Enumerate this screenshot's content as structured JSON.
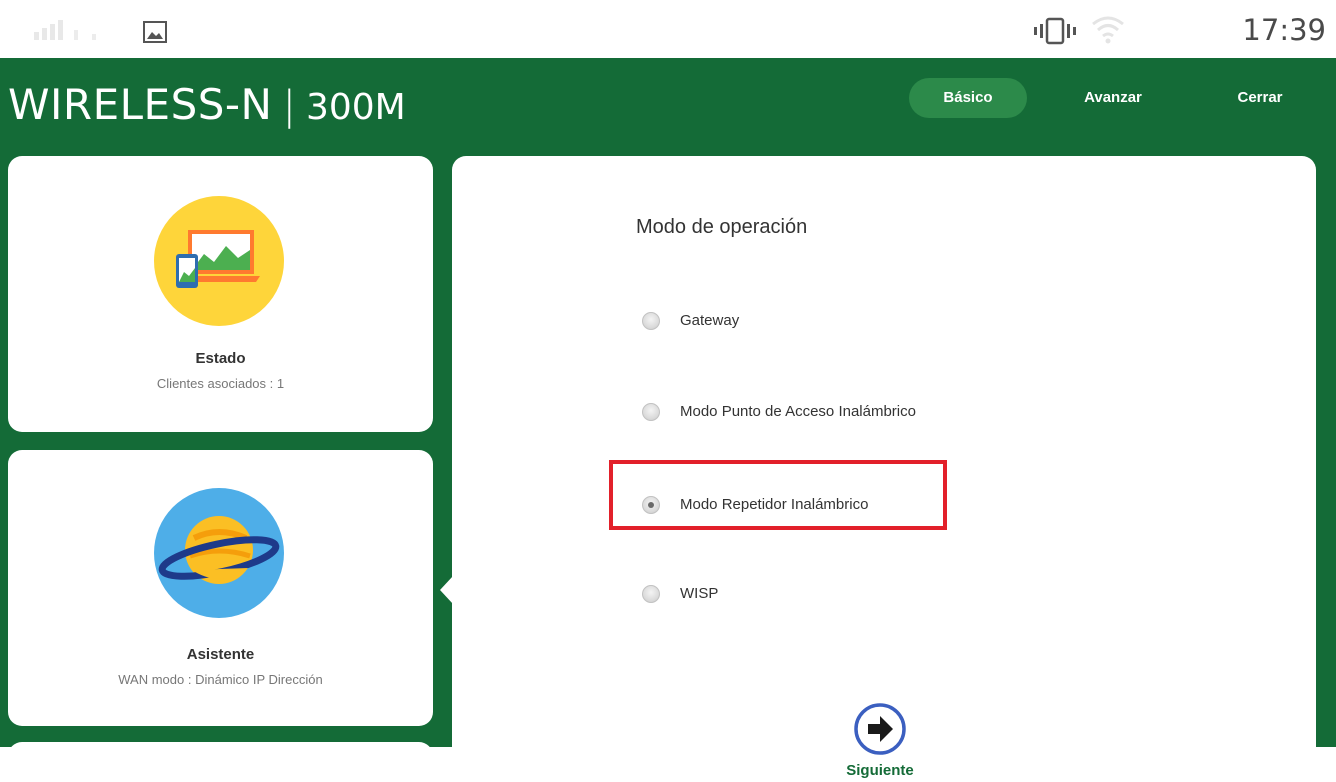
{
  "status_bar": {
    "time": "17:39",
    "icons": [
      "signal-icon",
      "image-icon",
      "vibrate-icon",
      "wifi-icon"
    ]
  },
  "header": {
    "brand_main": "WIRELESS-N",
    "brand_separator": "|",
    "brand_model": "300M",
    "nav": {
      "basico": "Básico",
      "avanzar": "Avanzar",
      "cerrar": "Cerrar"
    }
  },
  "sidebar": {
    "estado": {
      "title": "Estado",
      "subtitle": "Clientes asociados : 1",
      "icon": "monitor-devices-icon"
    },
    "asistente": {
      "title": "Asistente",
      "subtitle": "WAN modo : Dinámico IP Dirección",
      "icon": "planet-icon"
    }
  },
  "main": {
    "title": "Modo de operación",
    "options": [
      {
        "label": "Gateway",
        "checked": false
      },
      {
        "label": "Modo Punto de Acceso Inalámbrico",
        "checked": false
      },
      {
        "label": "Modo Repetidor Inalámbrico",
        "checked": true
      },
      {
        "label": "WISP",
        "checked": false
      }
    ],
    "next_label": "Siguiente",
    "next_icon": "arrow-right-circle-icon"
  },
  "colors": {
    "brand_green": "#146b37",
    "active_tab": "#2c8a4a",
    "highlight_red": "#e2202a"
  }
}
